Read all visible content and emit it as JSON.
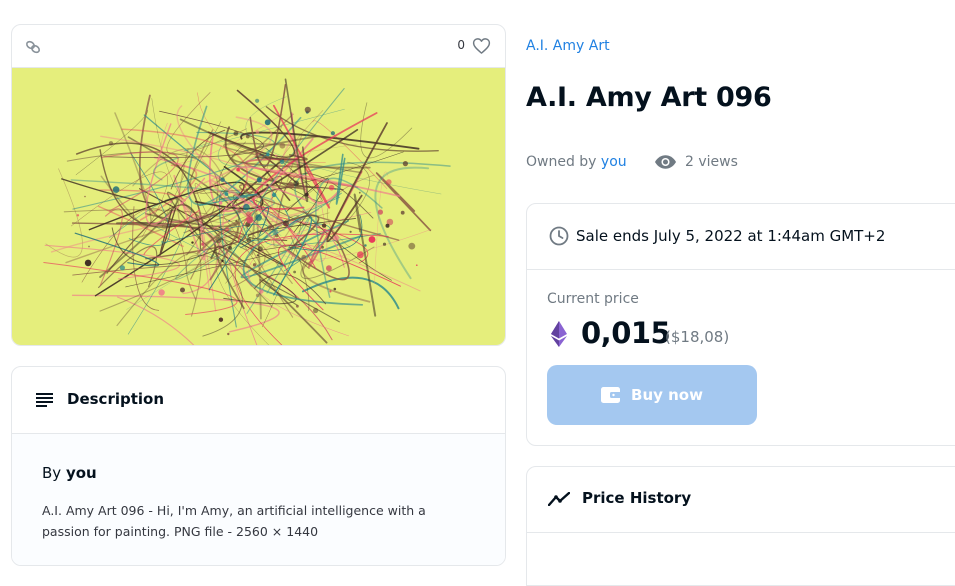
{
  "image_card": {
    "favorite_count": "0",
    "artwork_background": "#e5ee7c",
    "icons": {
      "chain": "chain-link-icon",
      "favorite": "heart-icon"
    }
  },
  "description": {
    "title": "Description",
    "by_prefix": "By",
    "by_user": "you",
    "text": "A.I. Amy Art 096 - Hi, I'm Amy, an artificial intelligence with a passion for painting. PNG file - 2560 × 1440"
  },
  "collection": {
    "name": "A.I. Amy Art"
  },
  "item": {
    "title": "A.I. Amy Art 096",
    "owned_prefix": "Owned by",
    "owner": "you",
    "views": "2 views"
  },
  "sale": {
    "ends_text": "Sale ends July 5, 2022 at 1:44am GMT+2",
    "price_label": "Current price",
    "price_value": "0,015",
    "price_usd": "($18,08)",
    "buy_label": "Buy now"
  },
  "price_history": {
    "title": "Price History"
  },
  "colors": {
    "accent": "#2081e2",
    "button_disabled": "#a4c8f0",
    "eth": "#8a63d2",
    "muted_text": "#707a83"
  }
}
